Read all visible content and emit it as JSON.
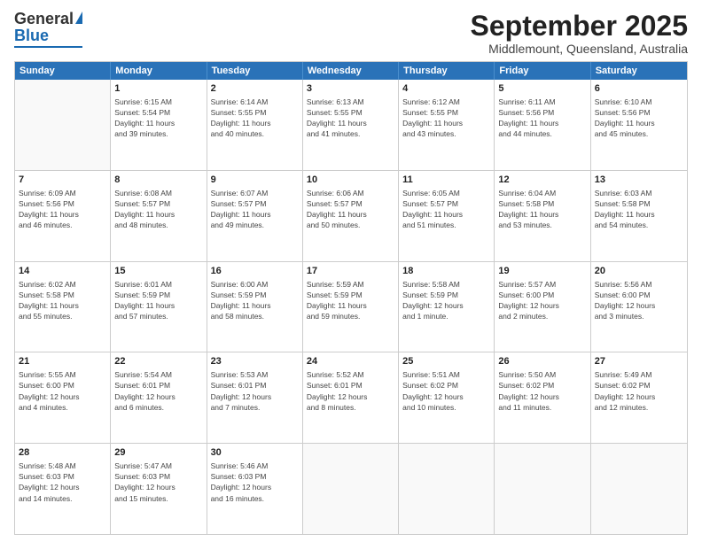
{
  "header": {
    "logo_general": "General",
    "logo_blue": "Blue",
    "month_title": "September 2025",
    "subtitle": "Middlemount, Queensland, Australia"
  },
  "days": [
    "Sunday",
    "Monday",
    "Tuesday",
    "Wednesday",
    "Thursday",
    "Friday",
    "Saturday"
  ],
  "rows": [
    [
      {
        "day": "",
        "text": ""
      },
      {
        "day": "1",
        "text": "Sunrise: 6:15 AM\nSunset: 5:54 PM\nDaylight: 11 hours\nand 39 minutes."
      },
      {
        "day": "2",
        "text": "Sunrise: 6:14 AM\nSunset: 5:55 PM\nDaylight: 11 hours\nand 40 minutes."
      },
      {
        "day": "3",
        "text": "Sunrise: 6:13 AM\nSunset: 5:55 PM\nDaylight: 11 hours\nand 41 minutes."
      },
      {
        "day": "4",
        "text": "Sunrise: 6:12 AM\nSunset: 5:55 PM\nDaylight: 11 hours\nand 43 minutes."
      },
      {
        "day": "5",
        "text": "Sunrise: 6:11 AM\nSunset: 5:56 PM\nDaylight: 11 hours\nand 44 minutes."
      },
      {
        "day": "6",
        "text": "Sunrise: 6:10 AM\nSunset: 5:56 PM\nDaylight: 11 hours\nand 45 minutes."
      }
    ],
    [
      {
        "day": "7",
        "text": "Sunrise: 6:09 AM\nSunset: 5:56 PM\nDaylight: 11 hours\nand 46 minutes."
      },
      {
        "day": "8",
        "text": "Sunrise: 6:08 AM\nSunset: 5:57 PM\nDaylight: 11 hours\nand 48 minutes."
      },
      {
        "day": "9",
        "text": "Sunrise: 6:07 AM\nSunset: 5:57 PM\nDaylight: 11 hours\nand 49 minutes."
      },
      {
        "day": "10",
        "text": "Sunrise: 6:06 AM\nSunset: 5:57 PM\nDaylight: 11 hours\nand 50 minutes."
      },
      {
        "day": "11",
        "text": "Sunrise: 6:05 AM\nSunset: 5:57 PM\nDaylight: 11 hours\nand 51 minutes."
      },
      {
        "day": "12",
        "text": "Sunrise: 6:04 AM\nSunset: 5:58 PM\nDaylight: 11 hours\nand 53 minutes."
      },
      {
        "day": "13",
        "text": "Sunrise: 6:03 AM\nSunset: 5:58 PM\nDaylight: 11 hours\nand 54 minutes."
      }
    ],
    [
      {
        "day": "14",
        "text": "Sunrise: 6:02 AM\nSunset: 5:58 PM\nDaylight: 11 hours\nand 55 minutes."
      },
      {
        "day": "15",
        "text": "Sunrise: 6:01 AM\nSunset: 5:59 PM\nDaylight: 11 hours\nand 57 minutes."
      },
      {
        "day": "16",
        "text": "Sunrise: 6:00 AM\nSunset: 5:59 PM\nDaylight: 11 hours\nand 58 minutes."
      },
      {
        "day": "17",
        "text": "Sunrise: 5:59 AM\nSunset: 5:59 PM\nDaylight: 11 hours\nand 59 minutes."
      },
      {
        "day": "18",
        "text": "Sunrise: 5:58 AM\nSunset: 5:59 PM\nDaylight: 12 hours\nand 1 minute."
      },
      {
        "day": "19",
        "text": "Sunrise: 5:57 AM\nSunset: 6:00 PM\nDaylight: 12 hours\nand 2 minutes."
      },
      {
        "day": "20",
        "text": "Sunrise: 5:56 AM\nSunset: 6:00 PM\nDaylight: 12 hours\nand 3 minutes."
      }
    ],
    [
      {
        "day": "21",
        "text": "Sunrise: 5:55 AM\nSunset: 6:00 PM\nDaylight: 12 hours\nand 4 minutes."
      },
      {
        "day": "22",
        "text": "Sunrise: 5:54 AM\nSunset: 6:01 PM\nDaylight: 12 hours\nand 6 minutes."
      },
      {
        "day": "23",
        "text": "Sunrise: 5:53 AM\nSunset: 6:01 PM\nDaylight: 12 hours\nand 7 minutes."
      },
      {
        "day": "24",
        "text": "Sunrise: 5:52 AM\nSunset: 6:01 PM\nDaylight: 12 hours\nand 8 minutes."
      },
      {
        "day": "25",
        "text": "Sunrise: 5:51 AM\nSunset: 6:02 PM\nDaylight: 12 hours\nand 10 minutes."
      },
      {
        "day": "26",
        "text": "Sunrise: 5:50 AM\nSunset: 6:02 PM\nDaylight: 12 hours\nand 11 minutes."
      },
      {
        "day": "27",
        "text": "Sunrise: 5:49 AM\nSunset: 6:02 PM\nDaylight: 12 hours\nand 12 minutes."
      }
    ],
    [
      {
        "day": "28",
        "text": "Sunrise: 5:48 AM\nSunset: 6:03 PM\nDaylight: 12 hours\nand 14 minutes."
      },
      {
        "day": "29",
        "text": "Sunrise: 5:47 AM\nSunset: 6:03 PM\nDaylight: 12 hours\nand 15 minutes."
      },
      {
        "day": "30",
        "text": "Sunrise: 5:46 AM\nSunset: 6:03 PM\nDaylight: 12 hours\nand 16 minutes."
      },
      {
        "day": "",
        "text": ""
      },
      {
        "day": "",
        "text": ""
      },
      {
        "day": "",
        "text": ""
      },
      {
        "day": "",
        "text": ""
      }
    ]
  ]
}
